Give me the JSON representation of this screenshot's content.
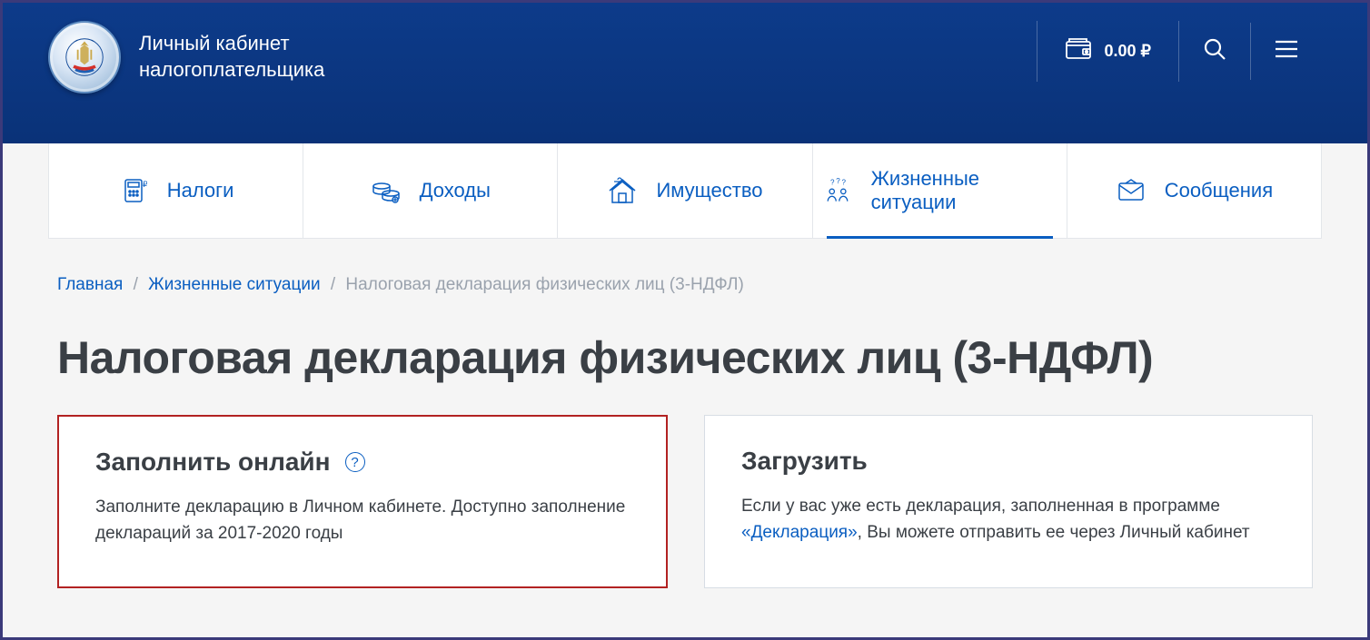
{
  "header": {
    "title_line1": "Личный кабинет",
    "title_line2": "налогоплательщика",
    "balance": "0.00 ₽"
  },
  "tabs": [
    {
      "label": "Налоги",
      "icon": "taxes"
    },
    {
      "label": "Доходы",
      "icon": "income"
    },
    {
      "label": "Имущество",
      "icon": "property"
    },
    {
      "label": "Жизненные ситуации",
      "icon": "life",
      "active": true
    },
    {
      "label": "Сообщения",
      "icon": "messages"
    }
  ],
  "breadcrumb": {
    "home": "Главная",
    "section": "Жизненные ситуации",
    "current": "Налоговая декларация физических лиц (3-НДФЛ)"
  },
  "page_title": "Налоговая декларация физических лиц (3-НДФЛ)",
  "cards": {
    "fill_online": {
      "title": "Заполнить онлайн",
      "text": "Заполните декларацию в Личном кабинете. Доступно заполнение деклараций за 2017-2020 годы"
    },
    "upload": {
      "title": "Загрузить",
      "text_before": "Если у вас уже есть декларация, заполненная в программе ",
      "link": "«Декларация»",
      "text_after": ", Вы можете отправить ее через Личный кабинет"
    }
  }
}
